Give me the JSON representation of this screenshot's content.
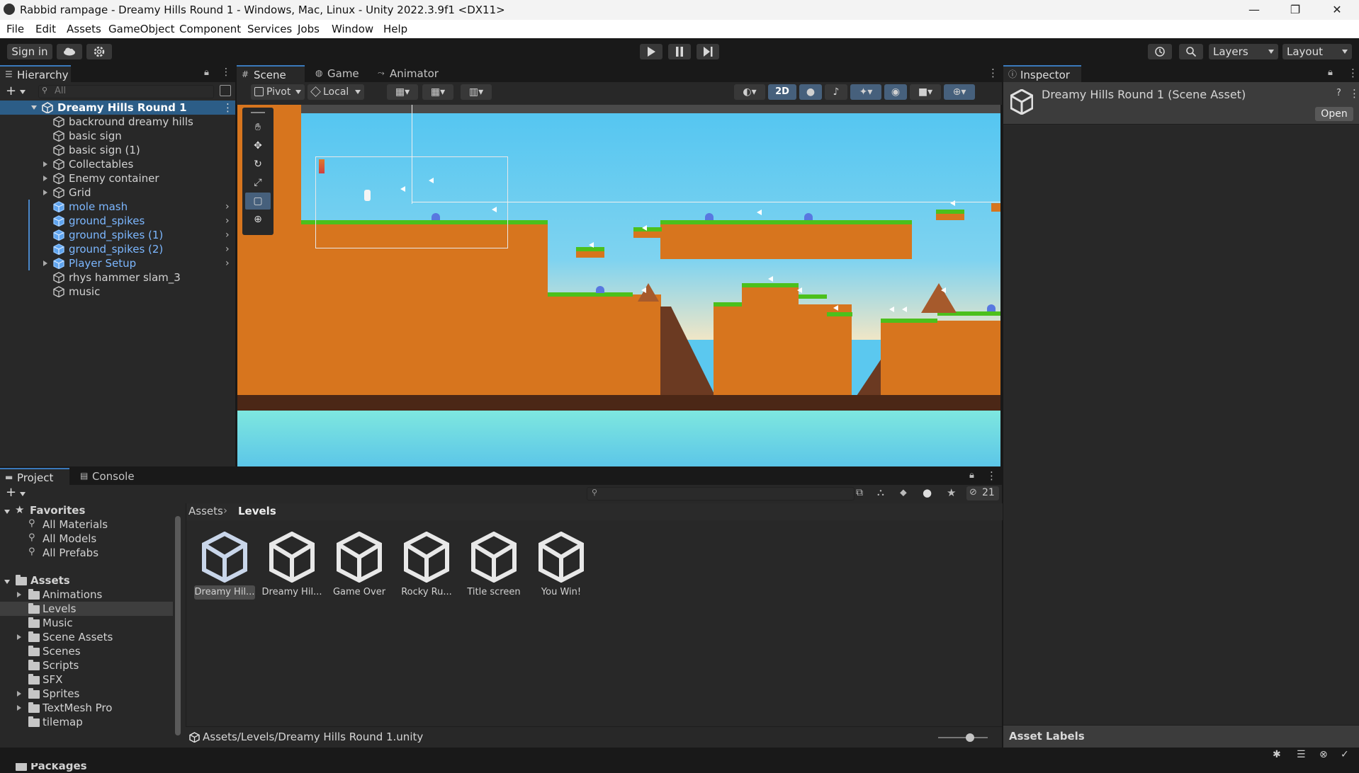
{
  "window": {
    "title": "Rabbid rampage - Dreamy Hills Round 1 - Windows, Mac, Linux - Unity 2022.3.9f1 <DX11>",
    "minimize": "—",
    "maximize": "❐",
    "close": "✕"
  },
  "menu": [
    "File",
    "Edit",
    "Assets",
    "GameObject",
    "Component",
    "Services",
    "Jobs",
    "Window",
    "Help"
  ],
  "toolbar": {
    "sign_in": "Sign in",
    "layers": "Layers",
    "layout": "Layout"
  },
  "hierarchy": {
    "tab": "Hierarchy",
    "search_placeholder": "All",
    "scene_name": "Dreamy Hills Round 1",
    "items": [
      {
        "label": "backround dreamy hills",
        "prefab": false,
        "expandable": false
      },
      {
        "label": "basic sign",
        "prefab": false,
        "expandable": false
      },
      {
        "label": "basic sign (1)",
        "prefab": false,
        "expandable": false
      },
      {
        "label": "Collectables",
        "prefab": false,
        "expandable": true
      },
      {
        "label": "Enemy container",
        "prefab": false,
        "expandable": true
      },
      {
        "label": "Grid",
        "prefab": false,
        "expandable": true
      },
      {
        "label": "mole mash",
        "prefab": true,
        "expandable": false
      },
      {
        "label": "ground_spikes",
        "prefab": true,
        "expandable": false
      },
      {
        "label": "ground_spikes (1)",
        "prefab": true,
        "expandable": false
      },
      {
        "label": "ground_spikes (2)",
        "prefab": true,
        "expandable": false
      },
      {
        "label": "Player Setup",
        "prefab": true,
        "expandable": true
      },
      {
        "label": "rhys hammer slam_3",
        "prefab": false,
        "expandable": false
      },
      {
        "label": "music",
        "prefab": false,
        "expandable": false
      }
    ]
  },
  "scene_tabs": {
    "scene": "Scene",
    "game": "Game",
    "animator": "Animator"
  },
  "scene_toolbar": {
    "pivot": "Pivot",
    "local": "Local",
    "mode_2d": "2D"
  },
  "inspector": {
    "tab": "Inspector",
    "title": "Dreamy Hills Round 1 (Scene Asset)",
    "open_button": "Open",
    "asset_labels": "Asset Labels"
  },
  "project": {
    "tab_project": "Project",
    "tab_console": "Console",
    "hidden_count": "21",
    "favorites_label": "Favorites",
    "favorites": [
      "All Materials",
      "All Models",
      "All Prefabs"
    ],
    "assets_label": "Assets",
    "folders": [
      {
        "label": "Animations",
        "expandable": true
      },
      {
        "label": "Levels",
        "expandable": false,
        "selected": true
      },
      {
        "label": "Music",
        "expandable": false
      },
      {
        "label": "Scene Assets",
        "expandable": true
      },
      {
        "label": "Scenes",
        "expandable": false
      },
      {
        "label": "Scripts",
        "expandable": false
      },
      {
        "label": "SFX",
        "expandable": false
      },
      {
        "label": "Sprites",
        "expandable": true
      },
      {
        "label": "TextMesh Pro",
        "expandable": true
      },
      {
        "label": "tilemap",
        "expandable": false
      }
    ],
    "packages_label": "Packages",
    "breadcrumb": [
      "Assets",
      "Levels"
    ],
    "assets": [
      "Dreamy Hil...",
      "Dreamy Hil...",
      "Game Over",
      "Rocky Ru...",
      "Title screen",
      "You Win!"
    ],
    "footer_path": "Assets/Levels/Dreamy Hills Round 1.unity"
  },
  "colors": {
    "selection": "#2c5d87",
    "prefab_text": "#7cb7ff",
    "sky": "#5bc8ef",
    "grass": "#4cc01c",
    "dirt": "#d7751e"
  }
}
